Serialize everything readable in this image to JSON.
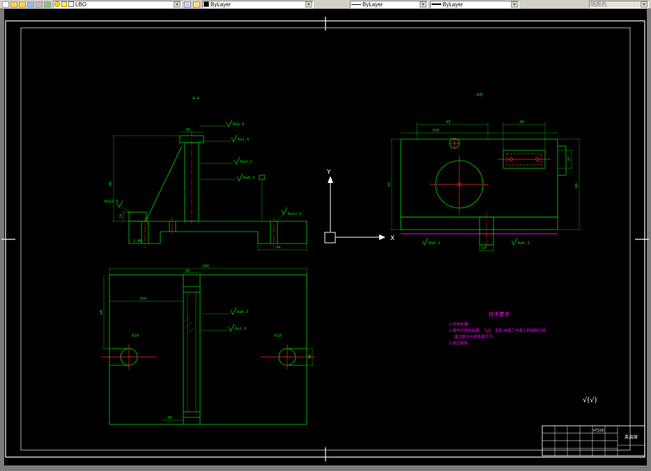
{
  "toolbar": {
    "layer_value": "LBO",
    "color_value": "ByLayer",
    "linetype_value": "ByLayer",
    "lineweight_value": "ByLayer",
    "plotstyle_value": "随颜色"
  },
  "ucs": {
    "x": "X",
    "y": "Y"
  },
  "front": {
    "section": "A—A",
    "ra1": "Ra1.6",
    "ra2": "Ra1.6",
    "ra3": "Ra3.2",
    "ra4": "Ra6.3",
    "ra_left": "Ra12.5",
    "ra_right": "Ra12.5",
    "dim_top": "30",
    "dim_h": "40",
    "dim_boss": "14",
    "dim_base": "94",
    "thread": "2-M8"
  },
  "side": {
    "label": "B向",
    "dim_45": "45",
    "dim_40": "40",
    "dim_100": "100",
    "dim_25": "25",
    "dim_80": "80",
    "dim_65": "65",
    "dim_14": "14",
    "ra_l": "Ra6.3",
    "ra_r": "Ra6.3"
  },
  "plan": {
    "dim_240": "240",
    "dim_45": "45",
    "dim_100": "100",
    "dim_68": "68",
    "dim_40": "40",
    "dim_30": "30",
    "r_left": "R10",
    "r_right": "R10",
    "ra1": "Ra6.3",
    "ra2": "Ra1.6"
  },
  "tech": {
    "title": "技术要求",
    "l1": "1.时效处理;",
    "l2": "2.铸件不得有砂眼、飞边、毛刺,夹具工作面上的缺陷应修",
    "l3": "磨平整并与原表面齐平;",
    "l4": "3.锐边倒钝。"
  },
  "tblock": {
    "material": "HT200",
    "name": "夹具体"
  },
  "misc": {
    "rest_mark": "√(√)"
  }
}
